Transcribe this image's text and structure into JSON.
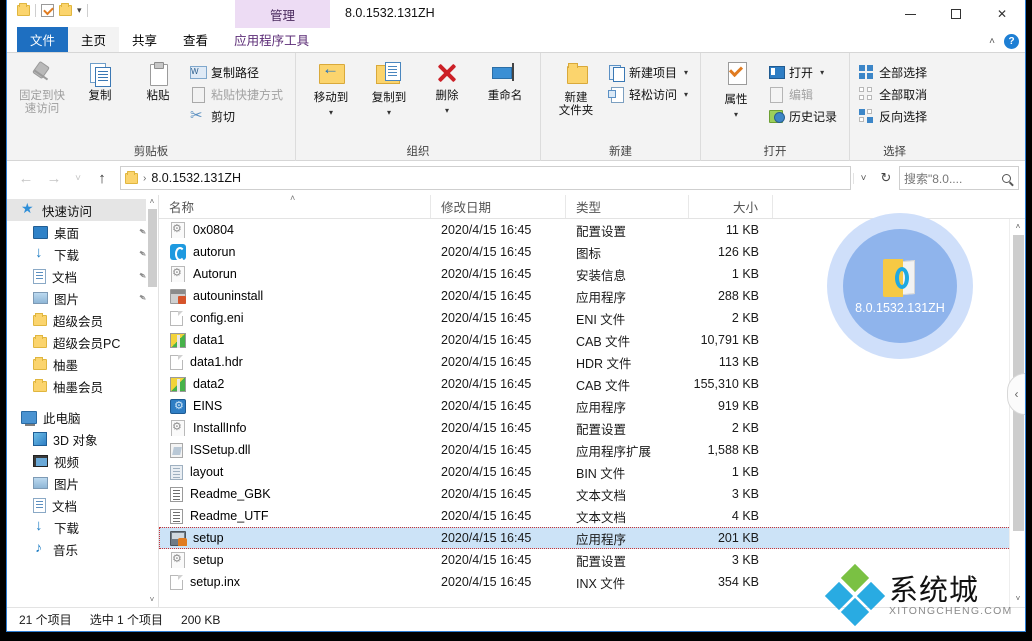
{
  "window": {
    "doc_title": "8.0.1532.131ZH",
    "contextual_tab": "管理",
    "minimize": "—",
    "maximize": "□",
    "close": "✕",
    "collapse_ribbon": "˄",
    "help": "?"
  },
  "quick_access_toolbar": {
    "folder_icon": "folder-icon",
    "properties_icon": "checkmark-icon",
    "new_folder_icon": "folder-icon",
    "customize_caret": "▾"
  },
  "tabs": [
    {
      "label": "文件",
      "state": "file-menu"
    },
    {
      "label": "主页",
      "state": "active"
    },
    {
      "label": "共享",
      "state": "normal"
    },
    {
      "label": "查看",
      "state": "normal"
    },
    {
      "label": "应用程序工具",
      "state": "contextual"
    }
  ],
  "ribbon": {
    "groups": [
      {
        "title": "剪贴板",
        "big_buttons": [
          {
            "label": "固定到快\n速访问",
            "line1": "固定到快",
            "line2": "速访问",
            "icon": "pin-icon",
            "disabled": true
          },
          {
            "label": "复制",
            "icon": "copy-icon",
            "disabled": false
          },
          {
            "label": "粘贴",
            "icon": "paste-icon",
            "disabled": false
          }
        ],
        "small_buttons": [
          {
            "label": "复制路径",
            "icon": "copy-path-icon",
            "disabled": false
          },
          {
            "label": "粘贴快捷方式",
            "icon": "paste-shortcut-icon",
            "disabled": true
          },
          {
            "label": "剪切",
            "icon": "scissors-icon",
            "disabled": false
          }
        ]
      },
      {
        "title": "组织",
        "big_buttons": [
          {
            "label": "移动到",
            "icon": "move-to-icon",
            "caret": "▾"
          },
          {
            "label": "复制到",
            "icon": "copy-to-icon",
            "caret": "▾"
          },
          {
            "label": "删除",
            "icon": "delete-icon",
            "caret": "▾"
          },
          {
            "label": "重命名",
            "icon": "rename-icon"
          }
        ]
      },
      {
        "title": "新建",
        "big_buttons": [
          {
            "line1": "新建",
            "line2": "文件夹",
            "icon": "new-folder-icon"
          }
        ],
        "small_buttons": [
          {
            "label": "新建项目",
            "icon": "new-item-icon",
            "caret": "▾"
          },
          {
            "label": "轻松访问",
            "icon": "easy-access-icon",
            "caret": "▾"
          }
        ]
      },
      {
        "title": "打开",
        "big_buttons": [
          {
            "label": "属性",
            "icon": "properties-icon",
            "caret": "▾"
          }
        ],
        "small_buttons": [
          {
            "label": "打开",
            "icon": "open-icon",
            "caret": "▾"
          },
          {
            "label": "编辑",
            "icon": "edit-icon",
            "disabled": true
          },
          {
            "label": "历史记录",
            "icon": "history-icon"
          }
        ]
      },
      {
        "title": "选择",
        "small_buttons": [
          {
            "label": "全部选择",
            "icon": "select-all-icon"
          },
          {
            "label": "全部取消",
            "icon": "select-none-icon"
          },
          {
            "label": "反向选择",
            "icon": "invert-selection-icon"
          }
        ]
      }
    ]
  },
  "address_bar": {
    "back": "←",
    "forward": "→",
    "recent": "˅",
    "up": "↑",
    "folder_icon": "folder-icon",
    "crumb_separator": "›",
    "path": "8.0.1532.131ZH",
    "dropdown_caret": "˅",
    "refresh": "↻",
    "search_placeholder": "搜索\"8.0...."
  },
  "navigation_pane": {
    "items": [
      {
        "label": "快速访问",
        "icon": "quick-access-star-icon",
        "level": 1,
        "selected": true,
        "pinned": false
      },
      {
        "label": "桌面",
        "icon": "desktop-icon",
        "level": 2,
        "pinned": true
      },
      {
        "label": "下载",
        "icon": "downloads-icon",
        "level": 2,
        "pinned": true
      },
      {
        "label": "文档",
        "icon": "documents-icon",
        "level": 2,
        "pinned": true
      },
      {
        "label": "图片",
        "icon": "pictures-icon",
        "level": 2,
        "pinned": true
      },
      {
        "label": "超级会员",
        "icon": "folder-icon",
        "level": 2,
        "pinned": false
      },
      {
        "label": "超级会员PC",
        "icon": "folder-icon",
        "level": 2,
        "pinned": false
      },
      {
        "label": "柚墨",
        "icon": "folder-icon",
        "level": 2,
        "pinned": false
      },
      {
        "label": "柚墨会员",
        "icon": "folder-icon",
        "level": 2,
        "pinned": false
      },
      {
        "label": "此电脑",
        "icon": "this-pc-icon",
        "level": 1,
        "gap_before": true
      },
      {
        "label": "3D 对象",
        "icon": "3d-objects-icon",
        "level": 2
      },
      {
        "label": "视频",
        "icon": "videos-icon",
        "level": 2
      },
      {
        "label": "图片",
        "icon": "pictures-icon",
        "level": 2
      },
      {
        "label": "文档",
        "icon": "documents-icon",
        "level": 2
      },
      {
        "label": "下载",
        "icon": "downloads-icon",
        "level": 2
      },
      {
        "label": "音乐",
        "icon": "music-icon",
        "level": 2
      }
    ],
    "pin_glyph": "✒",
    "scroll_up": "˄",
    "scroll_down": "˅"
  },
  "file_list": {
    "columns": [
      {
        "key": "name",
        "label": "名称",
        "sorted": true,
        "sort_glyph": "˄"
      },
      {
        "key": "date",
        "label": "修改日期"
      },
      {
        "key": "type",
        "label": "类型"
      },
      {
        "key": "size",
        "label": "大小"
      }
    ],
    "rows": [
      {
        "name": "0x0804",
        "date": "2020/4/15 16:45",
        "type": "配置设置",
        "size": "11 KB",
        "icon": "config-file-icon",
        "selected": false
      },
      {
        "name": "autorun",
        "date": "2020/4/15 16:45",
        "type": "图标",
        "size": "126 KB",
        "icon": "icon-file-icon",
        "selected": false
      },
      {
        "name": "Autorun",
        "date": "2020/4/15 16:45",
        "type": "安装信息",
        "size": "1 KB",
        "icon": "config-file-icon",
        "selected": false
      },
      {
        "name": "autouninstall",
        "date": "2020/4/15 16:45",
        "type": "应用程序",
        "size": "288 KB",
        "icon": "application-icon",
        "selected": false
      },
      {
        "name": "config.eni",
        "date": "2020/4/15 16:45",
        "type": "ENI 文件",
        "size": "2 KB",
        "icon": "blank-file-icon",
        "selected": false
      },
      {
        "name": "data1",
        "date": "2020/4/15 16:45",
        "type": "CAB 文件",
        "size": "10,791 KB",
        "icon": "cab-file-icon",
        "selected": false
      },
      {
        "name": "data1.hdr",
        "date": "2020/4/15 16:45",
        "type": "HDR 文件",
        "size": "113 KB",
        "icon": "blank-file-icon",
        "selected": false
      },
      {
        "name": "data2",
        "date": "2020/4/15 16:45",
        "type": "CAB 文件",
        "size": "155,310 KB",
        "icon": "cab-file-icon",
        "selected": false
      },
      {
        "name": "EINS",
        "date": "2020/4/15 16:45",
        "type": "应用程序",
        "size": "919 KB",
        "icon": "eins-app-icon",
        "selected": false
      },
      {
        "name": "InstallInfo",
        "date": "2020/4/15 16:45",
        "type": "配置设置",
        "size": "2 KB",
        "icon": "config-file-icon",
        "selected": false
      },
      {
        "name": "ISSetup.dll",
        "date": "2020/4/15 16:45",
        "type": "应用程序扩展",
        "size": "1,588 KB",
        "icon": "dll-file-icon",
        "selected": false
      },
      {
        "name": "layout",
        "date": "2020/4/15 16:45",
        "type": "BIN 文件",
        "size": "1 KB",
        "icon": "bin-file-icon",
        "selected": false
      },
      {
        "name": "Readme_GBK",
        "date": "2020/4/15 16:45",
        "type": "文本文档",
        "size": "3 KB",
        "icon": "text-file-icon",
        "selected": false
      },
      {
        "name": "Readme_UTF",
        "date": "2020/4/15 16:45",
        "type": "文本文档",
        "size": "4 KB",
        "icon": "text-file-icon",
        "selected": false
      },
      {
        "name": "setup",
        "date": "2020/4/15 16:45",
        "type": "应用程序",
        "size": "201 KB",
        "icon": "setup-app-icon",
        "selected": true
      },
      {
        "name": "setup",
        "date": "2020/4/15 16:45",
        "type": "配置设置",
        "size": "3 KB",
        "icon": "config-file-icon",
        "selected": false
      },
      {
        "name": "setup.inx",
        "date": "2020/4/15 16:45",
        "type": "INX 文件",
        "size": "354 KB",
        "icon": "blank-file-icon",
        "selected": false
      }
    ]
  },
  "preview_bubble": {
    "label": "8.0.1532.131ZH",
    "icon": "folder-open-icon"
  },
  "side_panel_toggle": "‹",
  "status_bar": {
    "item_count": "21 个项目",
    "selection": "选中 1 个项目",
    "selection_size": "200 KB"
  },
  "watermark": {
    "cn": "系统城",
    "en": "XITONGCHENG.COM"
  }
}
